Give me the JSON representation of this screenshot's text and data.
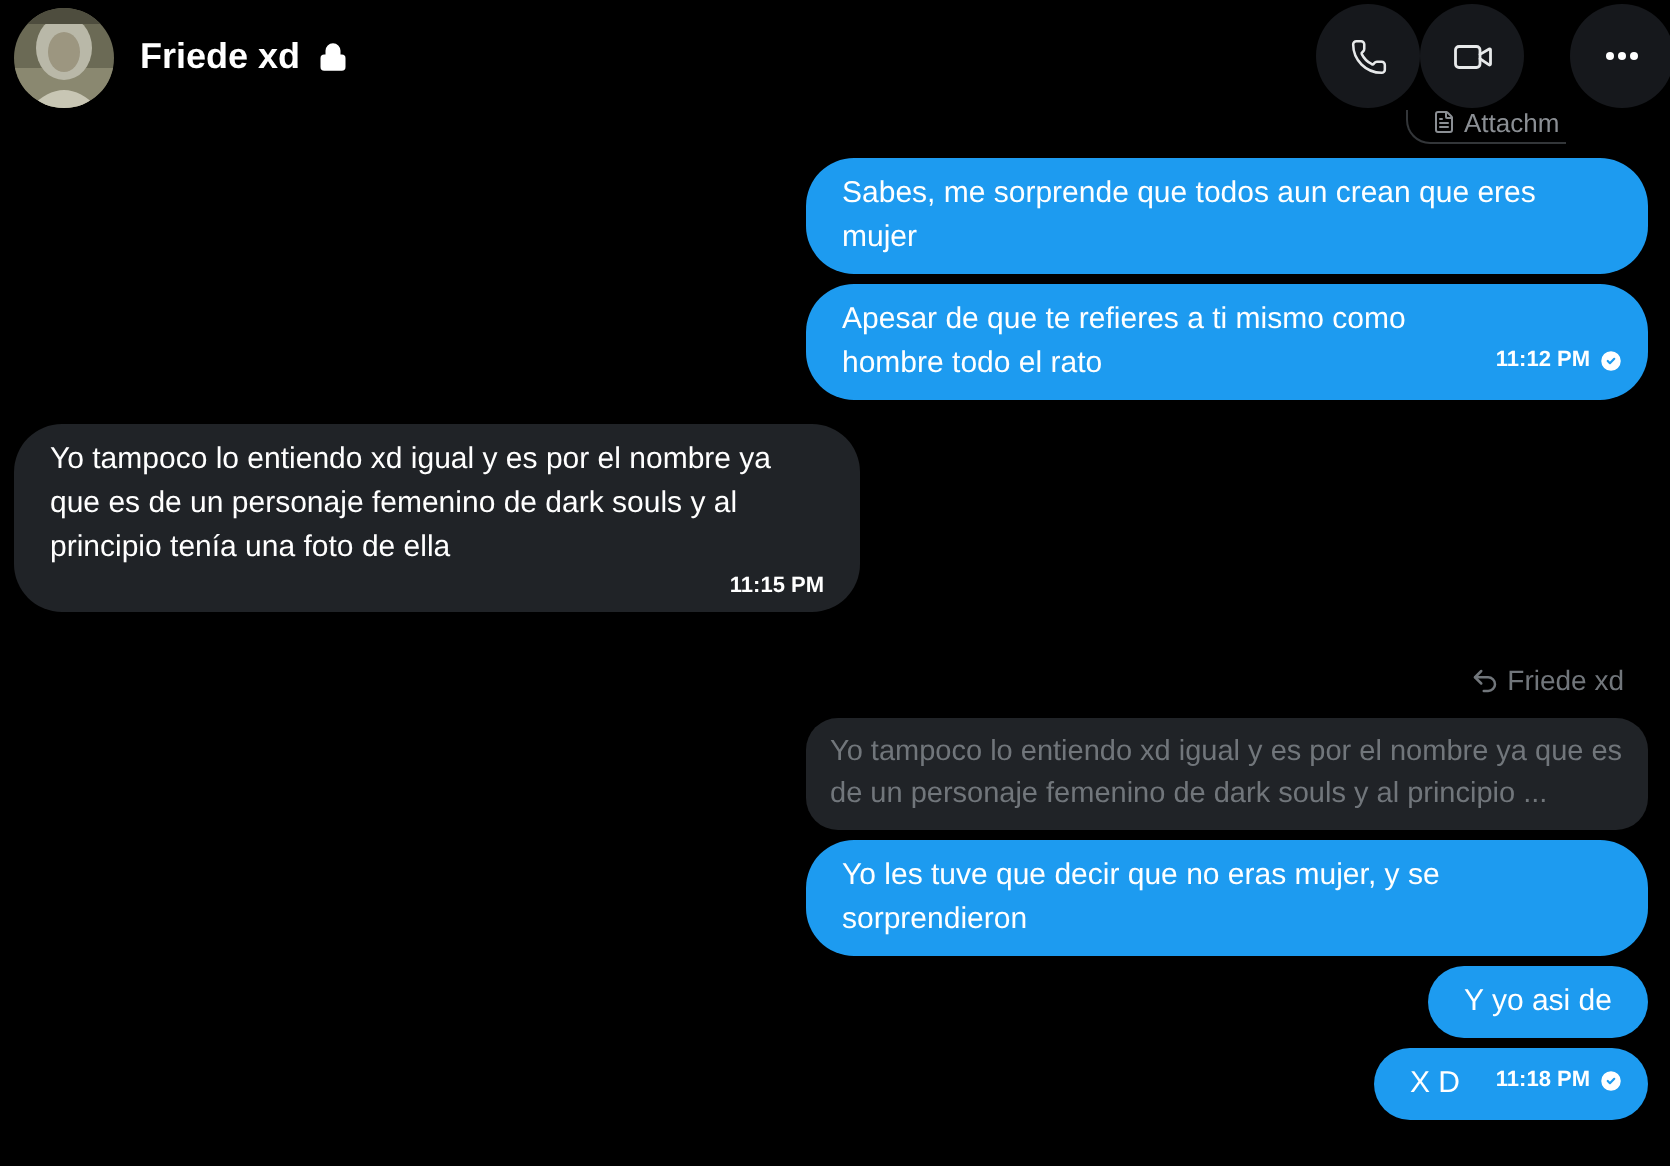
{
  "header": {
    "name": "Friede xd",
    "locked": true
  },
  "attachment_button": {
    "label": "Attachm"
  },
  "messages": [
    {
      "kind": "sent",
      "text": "Sabes, me sorprende que todos aun crean que eres mujer"
    },
    {
      "kind": "sent",
      "text": "Apesar de que te refieres a ti mismo como hombre todo el rato",
      "time": "11:12 PM",
      "read": true
    },
    {
      "kind": "received",
      "text": "Yo tampoco lo entiendo xd igual y es por el nombre ya que es de un personaje femenino de dark souls y al principio tenía una foto de ella",
      "time": "11:15 PM"
    },
    {
      "kind": "sent",
      "reply_to": "Friede xd",
      "quote": "Yo tampoco lo entiendo xd igual y es por el nombre ya que es de un personaje femenino de dark souls y al principio ...",
      "text": "Yo les tuve que decir que no eras mujer, y se sorprendieron"
    },
    {
      "kind": "sent",
      "text": "Y yo asi de"
    },
    {
      "kind": "sent",
      "text": "X D",
      "time": "11:18 PM",
      "read": true
    }
  ]
}
